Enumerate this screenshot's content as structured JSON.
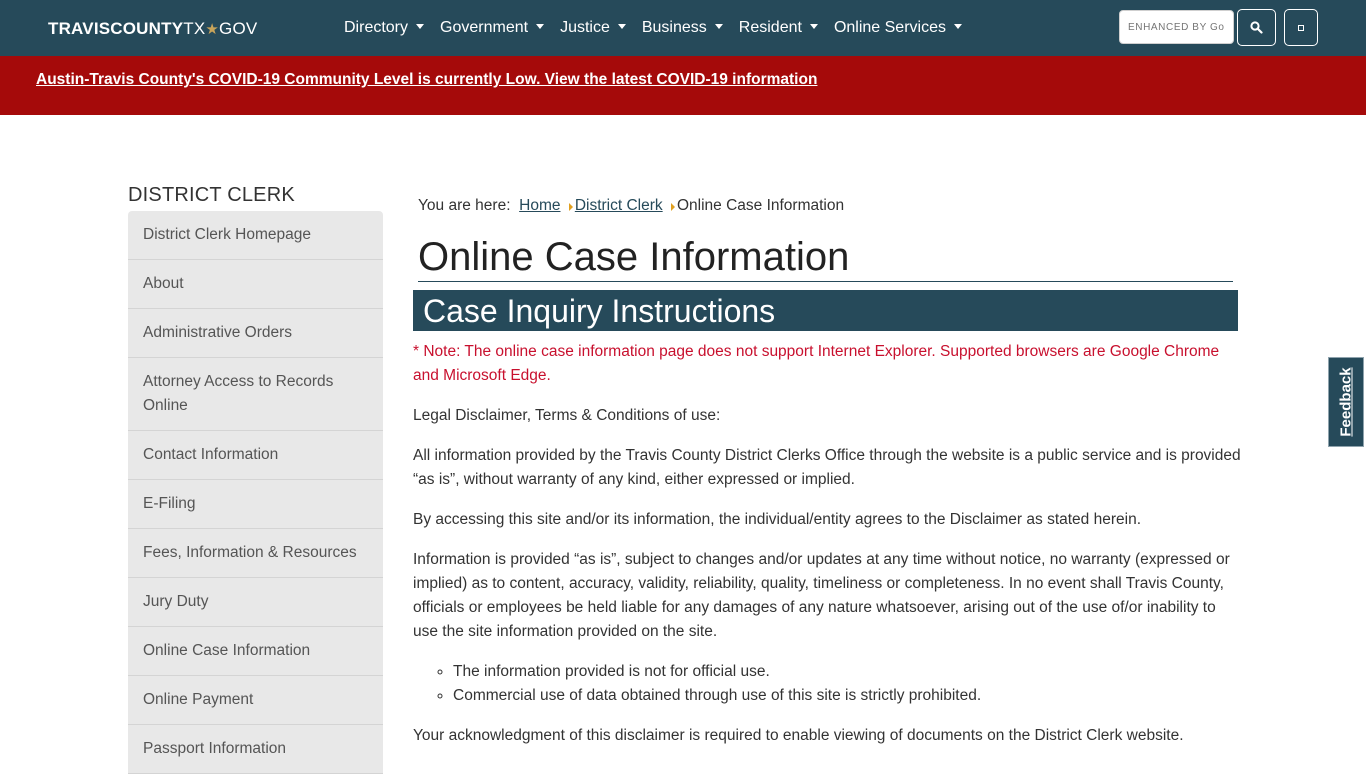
{
  "header": {
    "logo": {
      "part1": "TRAVISCOUNTY",
      "part2": "TX",
      "star": "★",
      "part3": "GOV"
    },
    "nav": [
      {
        "label": "Directory"
      },
      {
        "label": "Government"
      },
      {
        "label": "Justice"
      },
      {
        "label": "Business"
      },
      {
        "label": "Resident"
      },
      {
        "label": "Online Services"
      }
    ],
    "search": {
      "placeholder": "ENHANCED BY Google"
    },
    "icons": {
      "search": "search-icon",
      "menu": "menu-icon"
    }
  },
  "alert": {
    "text": "Austin-Travis County's COVID-19 Community Level is currently Low. View the latest COVID-19 information"
  },
  "sidebar": {
    "title": "DISTRICT CLERK",
    "items": [
      {
        "label": "District Clerk Homepage"
      },
      {
        "label": "About"
      },
      {
        "label": "Administrative Orders"
      },
      {
        "label": "Attorney Access to Records Online"
      },
      {
        "label": "Contact Information"
      },
      {
        "label": "E-Filing"
      },
      {
        "label": "Fees, Information & Resources"
      },
      {
        "label": "Jury Duty"
      },
      {
        "label": "Online Case Information"
      },
      {
        "label": "Online Payment"
      },
      {
        "label": "Passport Information"
      }
    ]
  },
  "breadcrumb": {
    "prefix": "You are here:",
    "home": "Home",
    "parent": "District Clerk",
    "current": "Online Case Information"
  },
  "main": {
    "title": "Online Case Information",
    "section_title": "Case Inquiry Instructions",
    "note": "* Note: The online case information page does not support Internet Explorer. Supported browsers are Google Chrome and Microsoft Edge.",
    "p1": "Legal Disclaimer, Terms & Conditions of use:",
    "p2": "All information provided by the Travis County District Clerks Office through the website is a public service and is provided “as is”, without warranty of any kind, either expressed or implied.",
    "p3": "By accessing this site and/or its information, the individual/entity agrees to the Disclaimer as stated herein.",
    "p4": "Information is provided “as is”, subject to changes and/or updates at any time without notice, no warranty (expressed or implied) as to content, accuracy, validity, reliability, quality, timeliness or completeness. In no event shall Travis County, officials or employees be held liable for any damages of any nature whatsoever, arising out of the use of/or inability to use the site information provided on the site.",
    "bullets": [
      "The information provided is not for official use.",
      "Commercial use of data obtained through use of this site is strictly prohibited."
    ],
    "p5": "Your acknowledgment of this disclaimer is required to enable viewing of documents on the District Clerk website."
  },
  "feedback": {
    "label": "Feedback"
  },
  "colors": {
    "header_bg": "#264a5a",
    "alert_bg": "#a50a0a",
    "note_text": "#c8102e",
    "sidebar_bg": "#e8e8e8",
    "breadcrumb_arrow": "#e0a020"
  }
}
